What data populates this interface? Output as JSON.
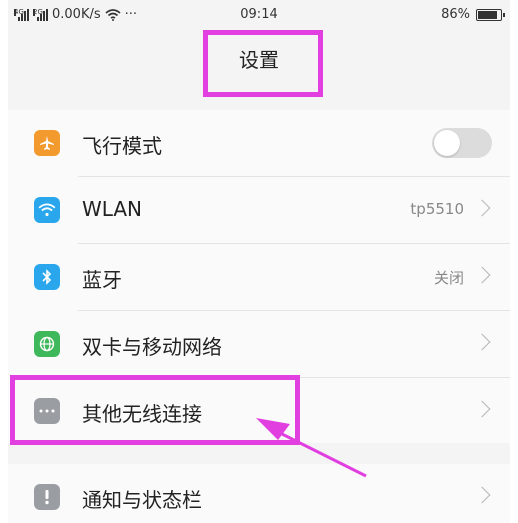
{
  "status_bar": {
    "net1_tag": "4G",
    "net2_tag": "2G",
    "speed": "0.00K/s",
    "more": "···",
    "time": "09:14",
    "battery_pct": "86%",
    "battery_level": 0.86
  },
  "header": {
    "title": "设置"
  },
  "settings": [
    {
      "label": "飞行模式",
      "icon": "airplane-icon",
      "icon_color": "#f29a2e",
      "control": "toggle",
      "toggle_on": false
    },
    {
      "label": "WLAN",
      "icon": "wifi-icon",
      "icon_color": "#2aa7ec",
      "value": "tp5510"
    },
    {
      "label": "蓝牙",
      "icon": "bluetooth-icon",
      "icon_color": "#2aa7ec",
      "value": "关闭"
    },
    {
      "label": "双卡与移动网络",
      "icon": "globe-icon",
      "icon_color": "#3fb85b",
      "value": ""
    },
    {
      "label": "其他无线连接",
      "icon": "more-dots-icon",
      "icon_color": "#9a9ea3",
      "value": ""
    },
    {
      "label": "通知与状态栏",
      "icon": "alert-icon",
      "icon_color": "#9a9ea3",
      "value": ""
    }
  ],
  "annotation": {
    "highlight_color": "#e13fe0"
  }
}
